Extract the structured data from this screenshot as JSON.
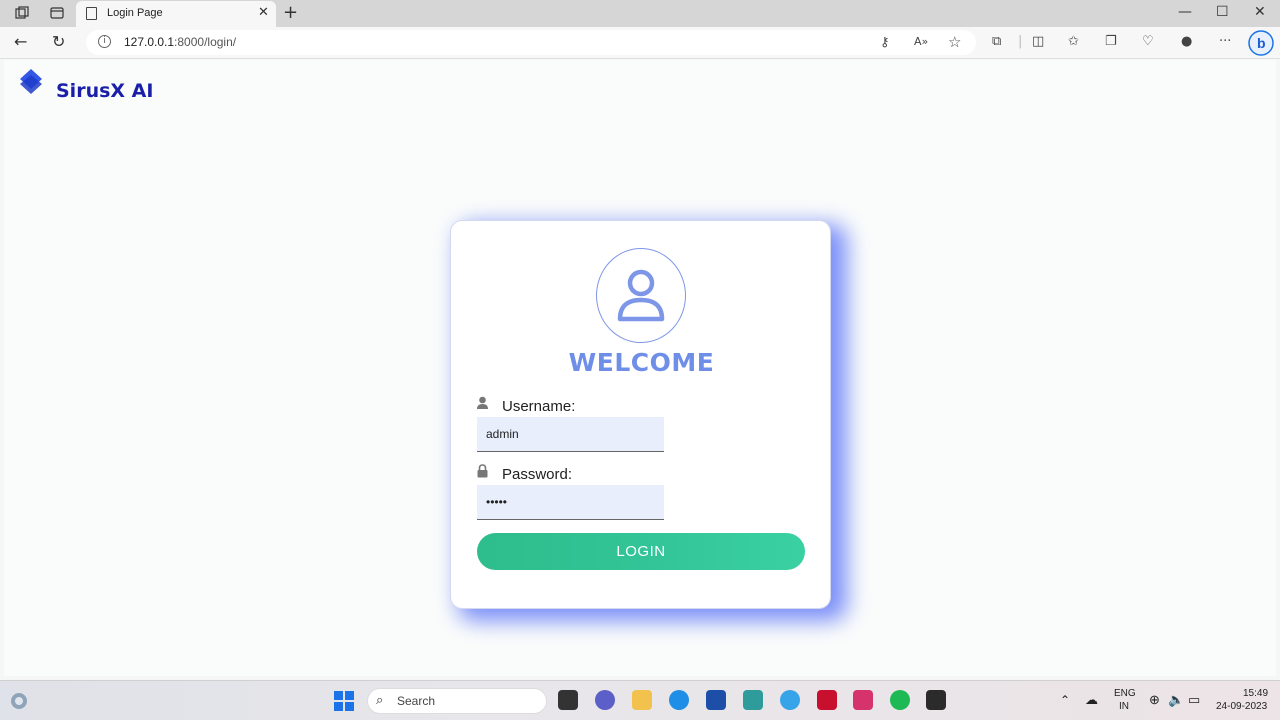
{
  "browser": {
    "tab_title": "Login Page",
    "url_host": "127.0.0.1",
    "url_rest": ":8000/login/"
  },
  "brand": {
    "name": "SirusX AI"
  },
  "login": {
    "heading": "WELCOME",
    "username_label": "Username:",
    "username_value": "admin",
    "password_label": "Password:",
    "password_value": "admin",
    "button_label": "LOGIN"
  },
  "taskbar": {
    "search_placeholder": "Search",
    "language_line1": "ENG",
    "language_line2": "IN",
    "time": "15:49",
    "date": "24-09-2023"
  },
  "colors": {
    "brand": "#1b1fa8",
    "accent": "#6f8ee8",
    "button": "#33c597",
    "card_shadow": "#7b8ff8"
  }
}
